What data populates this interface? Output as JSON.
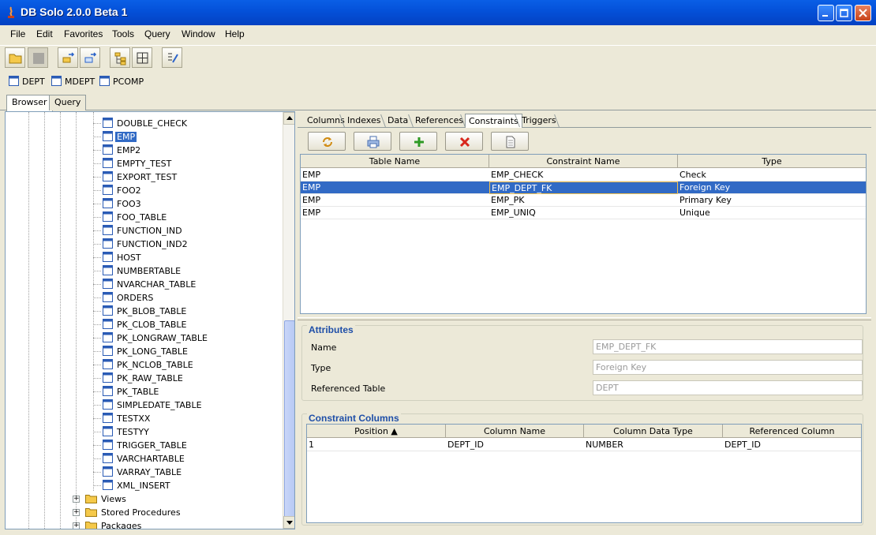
{
  "window": {
    "title": "DB Solo  2.0.0 Beta 1"
  },
  "menu": [
    "File",
    "Edit",
    "Favorites",
    "Tools",
    "Query",
    "Window",
    "Help"
  ],
  "toolbar": [
    "open-folder-icon",
    "stop-icon",
    "connect-icon",
    "disconnect-icon",
    "tree-icon",
    "grid-icon",
    "query-edit-icon"
  ],
  "quick_tables": [
    "DEPT",
    "MDEPT",
    "PCOMP"
  ],
  "main_tabs": [
    "Browser",
    "Query"
  ],
  "tree": {
    "tables": [
      "DOUBLE_CHECK",
      "EMP",
      "EMP2",
      "EMPTY_TEST",
      "EXPORT_TEST",
      "FOO2",
      "FOO3",
      "FOO_TABLE",
      "FUNCTION_IND",
      "FUNCTION_IND2",
      "HOST",
      "NUMBERTABLE",
      "NVARCHAR_TABLE",
      "ORDERS",
      "PK_BLOB_TABLE",
      "PK_CLOB_TABLE",
      "PK_LONGRAW_TABLE",
      "PK_LONG_TABLE",
      "PK_NCLOB_TABLE",
      "PK_RAW_TABLE",
      "PK_TABLE",
      "SIMPLEDATE_TABLE",
      "TESTXX",
      "TESTYY",
      "TRIGGER_TABLE",
      "VARCHARTABLE",
      "VARRAY_TABLE",
      "XML_INSERT"
    ],
    "selected": "EMP",
    "folders": [
      "Views",
      "Stored Procedures",
      "Packages"
    ]
  },
  "sub_tabs": [
    "Columns",
    "Indexes",
    "Data",
    "References",
    "Constraints",
    "Triggers"
  ],
  "active_sub_tab": "Constraints",
  "action_buttons": [
    "refresh-icon",
    "print-icon",
    "add-icon",
    "delete-icon",
    "document-icon"
  ],
  "constraints_table": {
    "headers": [
      "Table Name",
      "Constraint Name",
      "Type"
    ],
    "rows": [
      [
        "EMP",
        "EMP_CHECK",
        "Check"
      ],
      [
        "EMP",
        "EMP_DEPT_FK",
        "Foreign Key"
      ],
      [
        "EMP",
        "EMP_PK",
        "Primary Key"
      ],
      [
        "EMP",
        "EMP_UNIQ",
        "Unique"
      ]
    ],
    "selected_row": 1
  },
  "attributes": {
    "title": "Attributes",
    "fields": [
      {
        "label": "Name",
        "value": "EMP_DEPT_FK"
      },
      {
        "label": "Type",
        "value": "Foreign Key"
      },
      {
        "label": "Referenced Table",
        "value": "DEPT"
      }
    ]
  },
  "constraint_columns": {
    "title": "Constraint Columns",
    "headers": [
      "Position ▲",
      "Column Name",
      "Column Data Type",
      "Referenced Column"
    ],
    "rows": [
      [
        "1",
        "DEPT_ID",
        "NUMBER",
        "DEPT_ID"
      ]
    ]
  }
}
